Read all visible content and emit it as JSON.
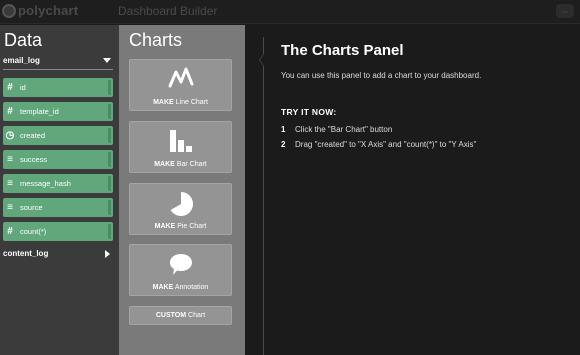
{
  "topbar": {
    "logo_text": "polychart",
    "title": "Dashboard Builder",
    "right_button_icon": "arrows-icon"
  },
  "data_panel": {
    "heading": "Data",
    "tables": [
      {
        "name": "email_log",
        "expanded": true,
        "fields": [
          {
            "label": "id",
            "icon": "#"
          },
          {
            "label": "template_id",
            "icon": "#"
          },
          {
            "label": "created",
            "icon": "◷"
          },
          {
            "label": "success",
            "icon": "≡"
          },
          {
            "label": "message_hash",
            "icon": "≡"
          },
          {
            "label": "source",
            "icon": "≡"
          },
          {
            "label": "count(*)",
            "icon": "#"
          }
        ]
      },
      {
        "name": "content_log",
        "expanded": false
      }
    ]
  },
  "charts_panel": {
    "heading": "Charts",
    "buttons": [
      {
        "prefix": "MAKE",
        "label": "Line Chart",
        "icon": "line-chart-icon"
      },
      {
        "prefix": "MAKE",
        "label": "Bar Chart",
        "icon": "bar-chart-icon"
      },
      {
        "prefix": "MAKE",
        "label": "Pie Chart",
        "icon": "pie-chart-icon"
      },
      {
        "prefix": "MAKE",
        "label": "Annotation",
        "icon": "speech-bubble-icon"
      }
    ],
    "custom": {
      "prefix": "CUSTOM",
      "label": "Chart"
    }
  },
  "help": {
    "title": "The Charts Panel",
    "description": "You can use this panel to add a chart to your dashboard.",
    "try_heading": "TRY IT NOW:",
    "steps": [
      {
        "num": "1",
        "text": "Click the \"Bar Chart\" button"
      },
      {
        "num": "2",
        "text": "Drag \"created\" to \"X Axis\" and \"count(*)\" to \"Y Axis\""
      }
    ]
  },
  "colors": {
    "field_green": "#61a77c",
    "data_panel_bg": "#3b3b3b",
    "charts_panel_bg": "#7a7a7a",
    "background": "#1b1b1b"
  }
}
